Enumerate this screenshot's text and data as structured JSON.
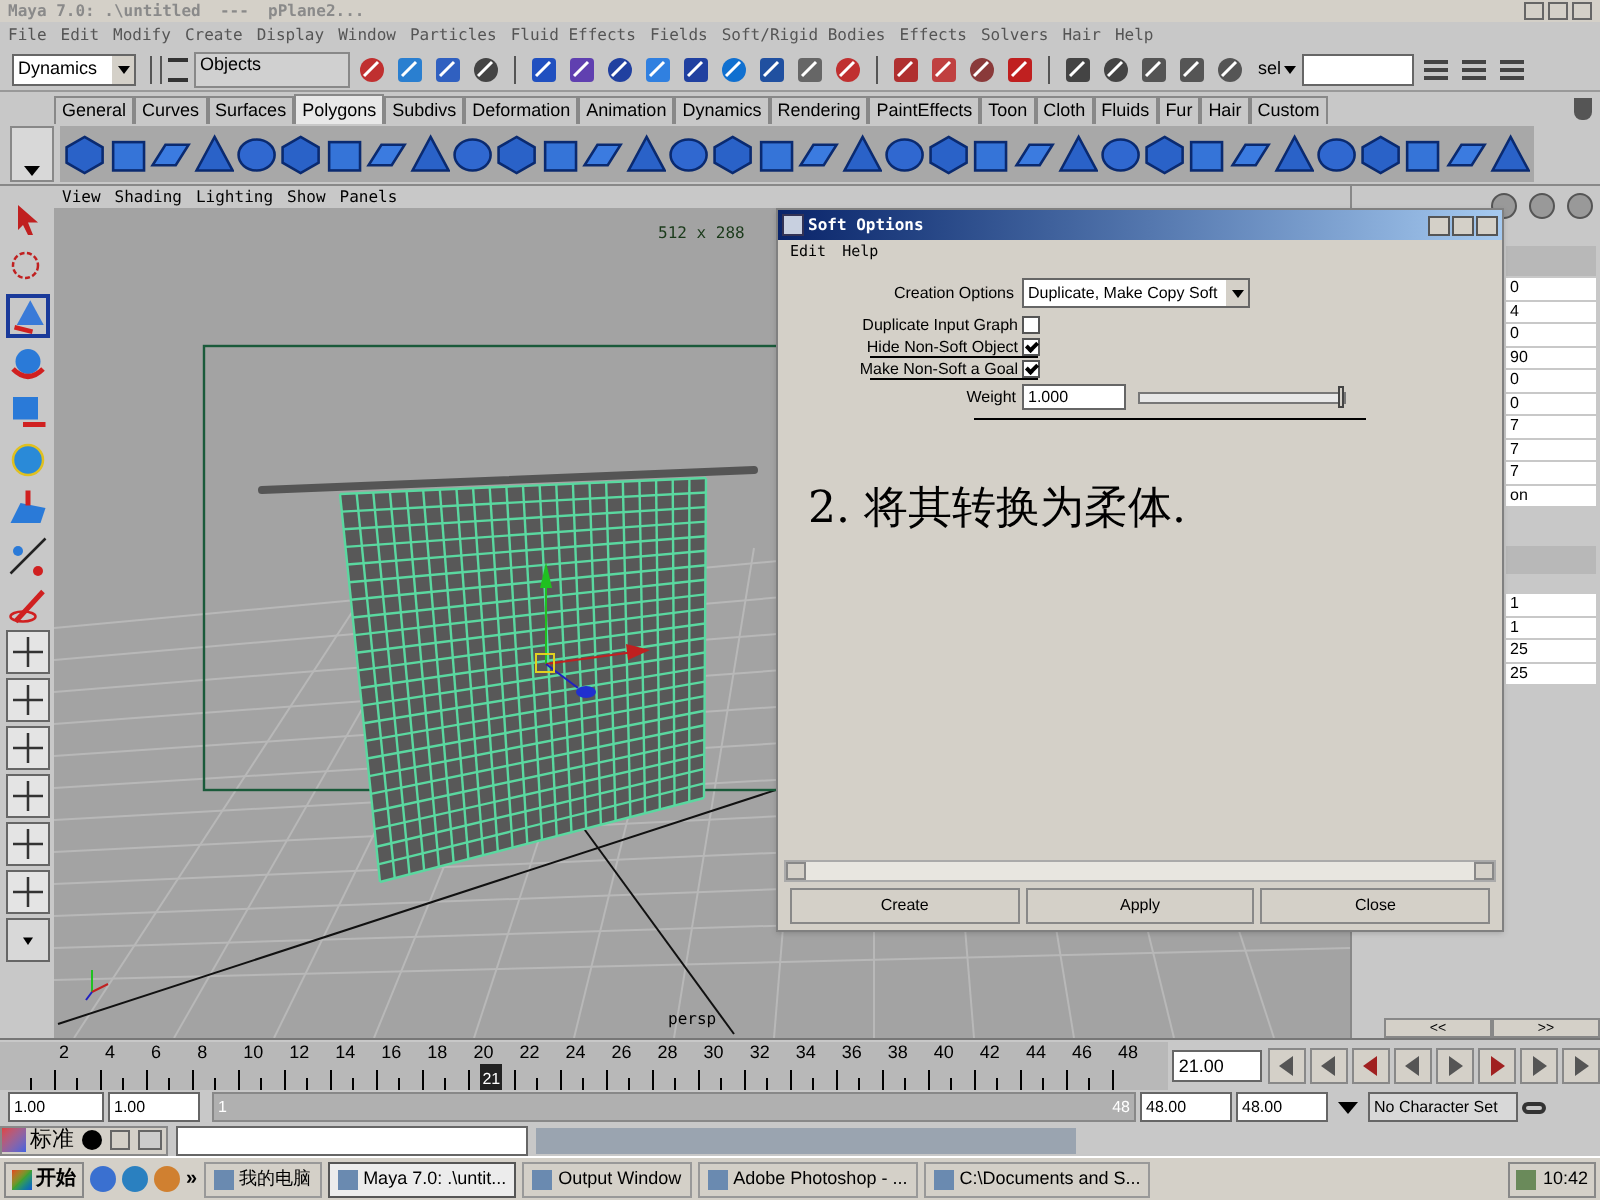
{
  "window": {
    "title": "Maya 7.0: .\\untitled  ---  pPlane2..."
  },
  "menu_bar": [
    "File",
    "Edit",
    "Modify",
    "Create",
    "Display",
    "Window",
    "Particles",
    "Fluid Effects",
    "Fields",
    "Soft/Rigid Bodies",
    "Effects",
    "Solvers",
    "Hair",
    "Help"
  ],
  "status_line": {
    "menu_set": "Dynamics",
    "selection_mode": "Objects",
    "quick_select": "sel"
  },
  "shelf": {
    "tabs": [
      {
        "label": "General",
        "selected": false
      },
      {
        "label": "Curves",
        "selected": false
      },
      {
        "label": "Surfaces",
        "selected": false
      },
      {
        "label": "Polygons",
        "selected": true
      },
      {
        "label": "Subdivs",
        "selected": false
      },
      {
        "label": "Deformation",
        "selected": false
      },
      {
        "label": "Animation",
        "selected": false
      },
      {
        "label": "Dynamics",
        "selected": false
      },
      {
        "label": "Rendering",
        "selected": false
      },
      {
        "label": "PaintEffects",
        "selected": false
      },
      {
        "label": "Toon",
        "selected": false
      },
      {
        "label": "Cloth",
        "selected": false
      },
      {
        "label": "Fluids",
        "selected": false
      },
      {
        "label": "Fur",
        "selected": false
      },
      {
        "label": "Hair",
        "selected": false
      },
      {
        "label": "Custom",
        "selected": false
      }
    ]
  },
  "viewport": {
    "menu": [
      "View",
      "Shading",
      "Lighting",
      "Show",
      "Panels"
    ],
    "resolution": "512 x 288",
    "camera": "persp"
  },
  "annotation": "2. 将其转换为柔体.",
  "channel_box": {
    "values": [
      "0",
      "4",
      "0",
      "90",
      "0",
      "0",
      "7",
      "7",
      "7",
      "on"
    ],
    "shape_values": [
      "1",
      "1",
      "25",
      "25"
    ],
    "nav": [
      "<<",
      ">>"
    ]
  },
  "soft_options": {
    "title": "Soft Options",
    "menu": [
      "Edit",
      "Help"
    ],
    "creation_options": {
      "label": "Creation Options",
      "value": "Duplicate, Make Copy Soft"
    },
    "checkboxes": [
      {
        "label": "Duplicate Input Graph",
        "checked": false
      },
      {
        "label": "Hide Non-Soft Object",
        "checked": true
      },
      {
        "label": "Make Non-Soft a Goal",
        "checked": true
      }
    ],
    "weight": {
      "label": "Weight",
      "value": "1.000",
      "level": 1
    },
    "buttons": [
      "Create",
      "Apply",
      "Close"
    ]
  },
  "time_slider": {
    "ticks": [
      "2",
      "4",
      "6",
      "8",
      "10",
      "12",
      "14",
      "16",
      "18",
      "20",
      "22",
      "24",
      "26",
      "28",
      "30",
      "32",
      "34",
      "36",
      "38",
      "40",
      "42",
      "44",
      "46",
      "48"
    ],
    "current_frame": "21",
    "level": 0.4255,
    "current_time": "21.00"
  },
  "range_slider": {
    "level": 1,
    "start_time": "1.00",
    "playback_start": "1.00",
    "range_start": "1",
    "range_end": "48",
    "playback_end": "48.00",
    "end_time": "48.00",
    "character_set": "No Character Set"
  },
  "command_line": {
    "ime_mode": "标准"
  },
  "taskbar": {
    "start": "开始",
    "more": "»",
    "items": [
      {
        "label": "我的电脑",
        "selected": false
      },
      {
        "label": "Maya 7.0: .\\untit...",
        "selected": true
      },
      {
        "label": "Output Window",
        "selected": false
      },
      {
        "label": "Adobe Photoshop - ...",
        "selected": false
      },
      {
        "label": "C:\\Documents and S...",
        "selected": false
      }
    ],
    "clock": "10:42"
  }
}
